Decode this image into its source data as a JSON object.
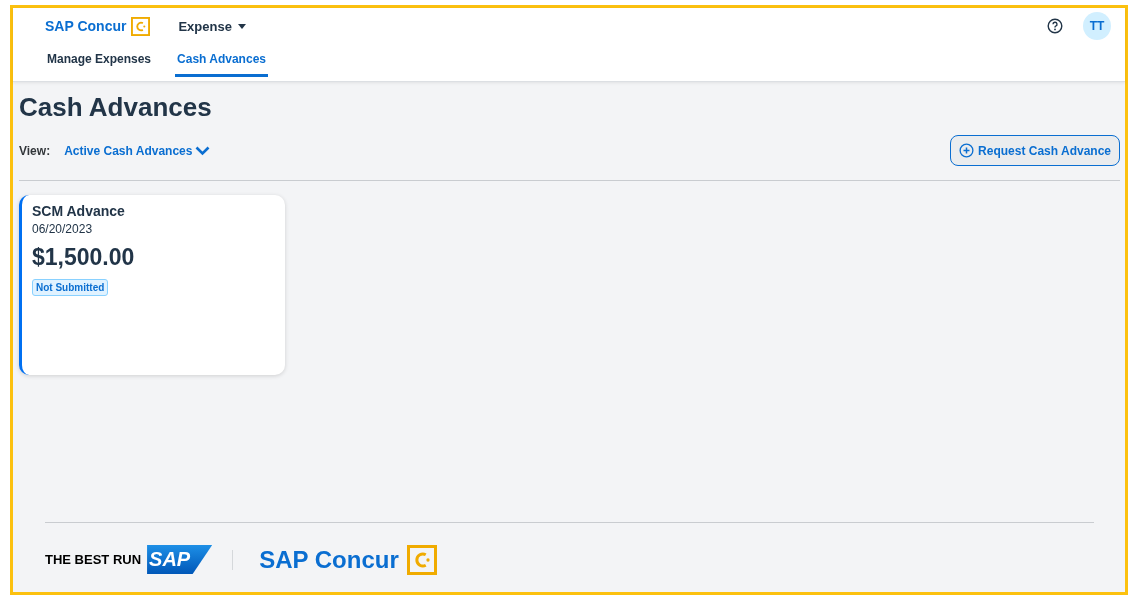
{
  "header": {
    "brand": "SAP Concur",
    "product_menu": "Expense",
    "avatar": "TT"
  },
  "tabs": [
    {
      "label": "Manage Expenses",
      "selected": false
    },
    {
      "label": "Cash Advances",
      "selected": true
    }
  ],
  "page": {
    "title": "Cash Advances",
    "view_label": "View:",
    "view_value": "Active Cash Advances",
    "request_button": "Request Cash Advance"
  },
  "cards": [
    {
      "title": "SCM Advance",
      "date": "06/20/2023",
      "amount": "$1,500.00",
      "status": "Not Submitted",
      "selected": true
    }
  ],
  "footer": {
    "tagline": "THE BEST RUN",
    "sap_logo": "SAP",
    "brand": "SAP Concur"
  }
}
